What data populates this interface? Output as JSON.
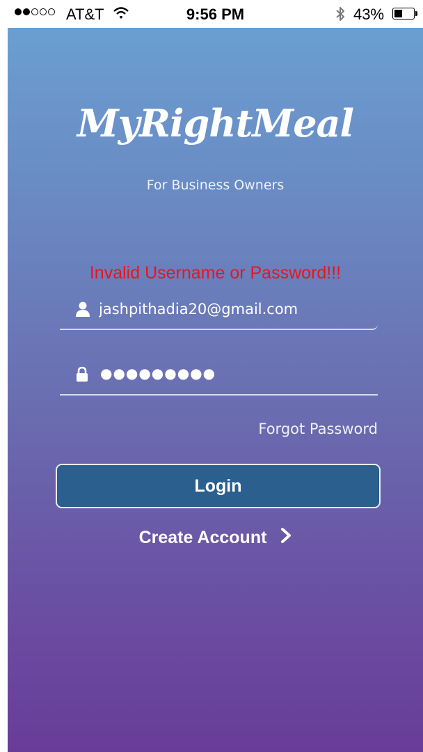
{
  "status_bar": {
    "carrier": "AT&T",
    "time": "9:56 PM",
    "battery_percent": "43%",
    "battery_level": 0.43,
    "signal_bars_filled": 2,
    "signal_bars_total": 5
  },
  "app": {
    "logo_text": "MyRightMeal",
    "subtitle": "For Business Owners"
  },
  "login_form": {
    "error_message": "Invalid Username or Password!!!",
    "email_value": "jashpithadia20@gmail.com",
    "password_masked": "●●●●●●●●●",
    "forgot_password_label": "Forgot Password",
    "login_button_label": "Login",
    "create_account_label": "Create Account"
  },
  "colors": {
    "error": "#e8151e",
    "button": "#2b5f8e",
    "gradient_top": "#6aa2d3",
    "gradient_bottom": "#693c98"
  },
  "icons": {
    "user": "user-icon",
    "lock": "lock-icon",
    "chevron": "chevron-right-icon"
  }
}
